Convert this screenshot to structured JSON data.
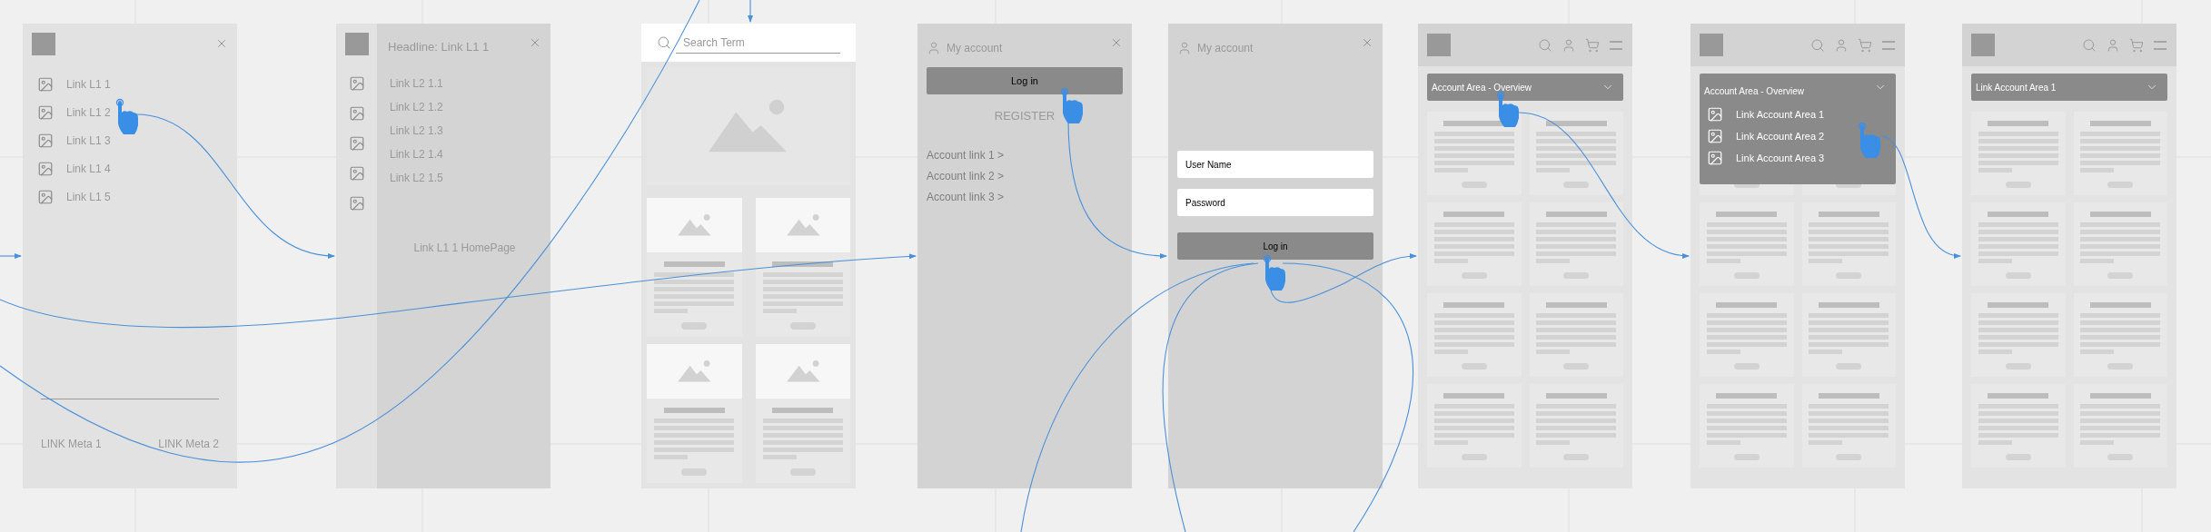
{
  "screens": [
    {
      "kind": "menu",
      "links": [
        "Link L1 1",
        "Link L1 2",
        "Link L1 3",
        "Link L1 4",
        "Link L1 5"
      ],
      "meta_links": [
        "LINK Meta 1",
        "LINK Meta 2"
      ]
    },
    {
      "kind": "submenu",
      "headline": "Headline: Link L1 1",
      "links": [
        "Link L2 1.1",
        "Link L2 1.2",
        "Link L2 1.3",
        "Link L2 1.4",
        "Link L2 1.5"
      ],
      "home_link": "Link L1 1 HomePage"
    },
    {
      "kind": "search",
      "placeholder": "Search Term"
    },
    {
      "kind": "account",
      "title": "My account",
      "button": "Log in",
      "register": "REGISTER",
      "links": [
        "Account link 1 >",
        "Account link 2 >",
        "Account link 3 >"
      ]
    },
    {
      "kind": "login",
      "title": "My account",
      "fields": [
        {
          "placeholder": "User Name"
        },
        {
          "placeholder": "Password"
        }
      ],
      "button": "Log in"
    },
    {
      "kind": "overview",
      "dropdown": {
        "label": "Account Area - Overview",
        "expanded": false
      }
    },
    {
      "kind": "overview",
      "dropdown": {
        "label": "Account Area - Overview",
        "expanded": true,
        "options": [
          "Link Account Area 1",
          "Link Account Area 2",
          "Link Account Area 3"
        ]
      }
    },
    {
      "kind": "overview",
      "dropdown": {
        "label": "Link Account Area 1",
        "expanded": false
      }
    }
  ]
}
